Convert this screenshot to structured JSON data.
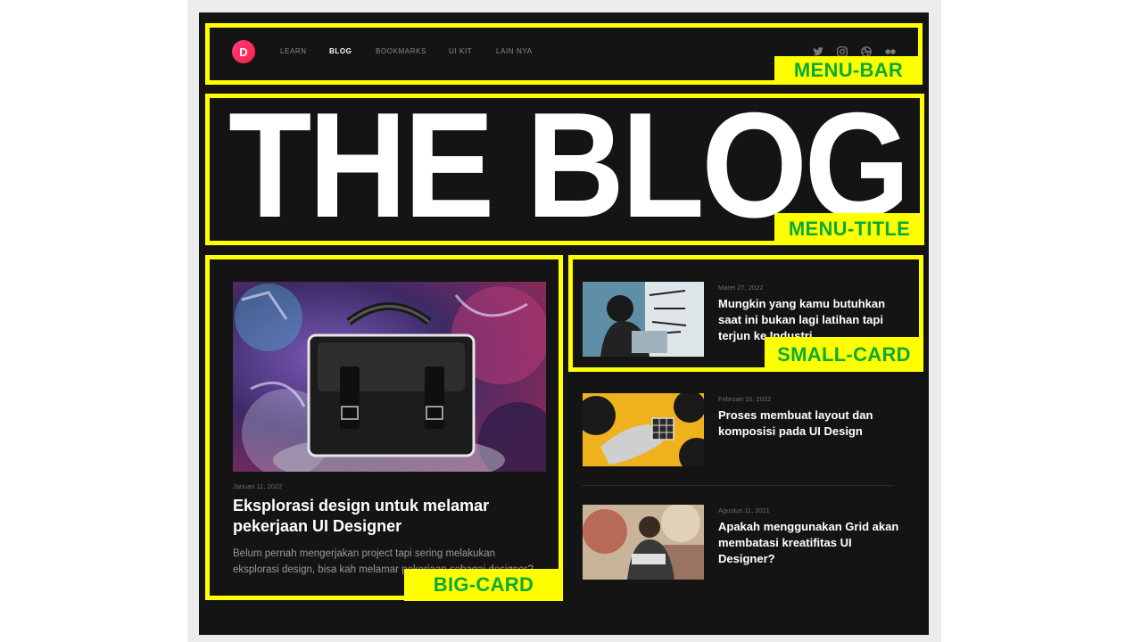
{
  "nav": {
    "logo_letter": "D",
    "items": [
      "LEARN",
      "BLOG",
      "BOOKMARKS",
      "UI KIT",
      "LAIN NYA"
    ],
    "active": "BLOG",
    "social_icons": [
      "twitter-icon",
      "instagram-icon",
      "dribbble-icon",
      "flickr-icon"
    ]
  },
  "hero": {
    "title": "THE BLOG"
  },
  "big_card": {
    "date": "Januari 11, 2022",
    "title": "Eksplorasi design untuk melamar pekerjaan UI Designer",
    "description": "Belum pernah mengerjakan project tapi sering melakukan eksplorasi design, bisa kah melamar pekerjaan sebagai designer?"
  },
  "small_cards": [
    {
      "date": "Maret 27, 2022",
      "title": "Mungkin yang kamu butuhkan saat ini bukan lagi latihan tapi terjun ke Industri"
    },
    {
      "date": "Februari 15, 2022",
      "title": "Proses membuat layout dan komposisi pada UI Design"
    },
    {
      "date": "Agustus 11, 2021",
      "title": "Apakah menggunakan Grid akan membatasi kreatifitas UI Designer?"
    }
  ],
  "annotations": {
    "menu_bar": "MENU-BAR",
    "menu_title": "MENU-TITLE",
    "big_card": "BIG-CARD",
    "small_card": "SMALL-CARD"
  },
  "colors": {
    "background": "#141414",
    "annotation_border": "#ffff00",
    "annotation_text": "#0aaa3a",
    "logo": "#ff2d5e"
  }
}
